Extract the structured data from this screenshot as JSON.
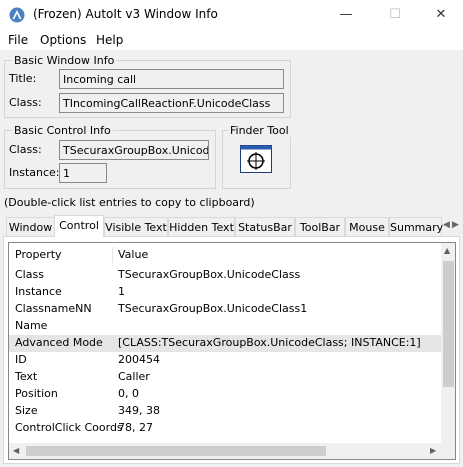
{
  "window": {
    "title": "(Frozen) AutoIt v3 Window Info",
    "minimize_glyph": "—",
    "maximize_glyph": "☐",
    "close_glyph": "✕"
  },
  "menu": {
    "file": "File",
    "options": "Options",
    "help": "Help"
  },
  "basic_window_info": {
    "legend": "Basic Window Info",
    "title_label": "Title:",
    "title_value": "Incoming call",
    "class_label": "Class:",
    "class_value": "TIncomingCallReactionF.UnicodeClass"
  },
  "basic_control_info": {
    "legend": "Basic Control Info",
    "class_label": "Class:",
    "class_value": "TSecuraxGroupBox.UnicodeCl",
    "instance_label": "Instance:",
    "instance_value": "1"
  },
  "finder_tool": {
    "legend": "Finder Tool",
    "icon": "crosshair-target-icon"
  },
  "hint": "(Double-click list entries to copy to clipboard)",
  "tabs": [
    {
      "label": "Window"
    },
    {
      "label": "Control"
    },
    {
      "label": "Visible Text"
    },
    {
      "label": "Hidden Text"
    },
    {
      "label": "StatusBar"
    },
    {
      "label": "ToolBar"
    },
    {
      "label": "Mouse"
    },
    {
      "label": "Summary"
    }
  ],
  "list": {
    "columns": {
      "property": "Property",
      "value": "Value"
    },
    "rows": [
      {
        "property": "Class",
        "value": "TSecuraxGroupBox.UnicodeClass"
      },
      {
        "property": "Instance",
        "value": "1"
      },
      {
        "property": "ClassnameNN",
        "value": "TSecuraxGroupBox.UnicodeClass1"
      },
      {
        "property": "Name",
        "value": ""
      },
      {
        "property": "Advanced Mode",
        "value": "[CLASS:TSecuraxGroupBox.UnicodeClass; INSTANCE:1]"
      },
      {
        "property": "ID",
        "value": "200454"
      },
      {
        "property": "Text",
        "value": "Caller"
      },
      {
        "property": "Position",
        "value": "0, 0"
      },
      {
        "property": "Size",
        "value": "349, 38"
      },
      {
        "property": "ControlClick Coords",
        "value": "78, 27"
      }
    ]
  }
}
